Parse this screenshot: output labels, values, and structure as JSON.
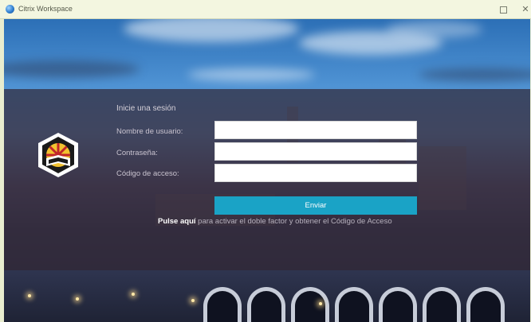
{
  "window": {
    "title": "Citrix Workspace",
    "maximize_icon": "maximize-icon",
    "close_icon": "close-icon",
    "close_glyph": "✕"
  },
  "login": {
    "heading": "Inicie una sesión",
    "username_label": "Nombre de usuario:",
    "password_label": "Contraseña:",
    "code_label": "Código de acceso:",
    "username_value": "",
    "password_value": "",
    "code_value": "",
    "submit_label": "Enviar",
    "hint_link": "Pulse aquí",
    "hint_text": " para activar el doble factor y obtener el Código de Acceso"
  },
  "colors": {
    "accent": "#1aa3c6",
    "panel": "#302a3a",
    "crest_red": "#c0262a",
    "crest_gold": "#f2c230"
  },
  "icons": {
    "app": "citrix-app-icon",
    "crest": "university-crest-icon"
  }
}
